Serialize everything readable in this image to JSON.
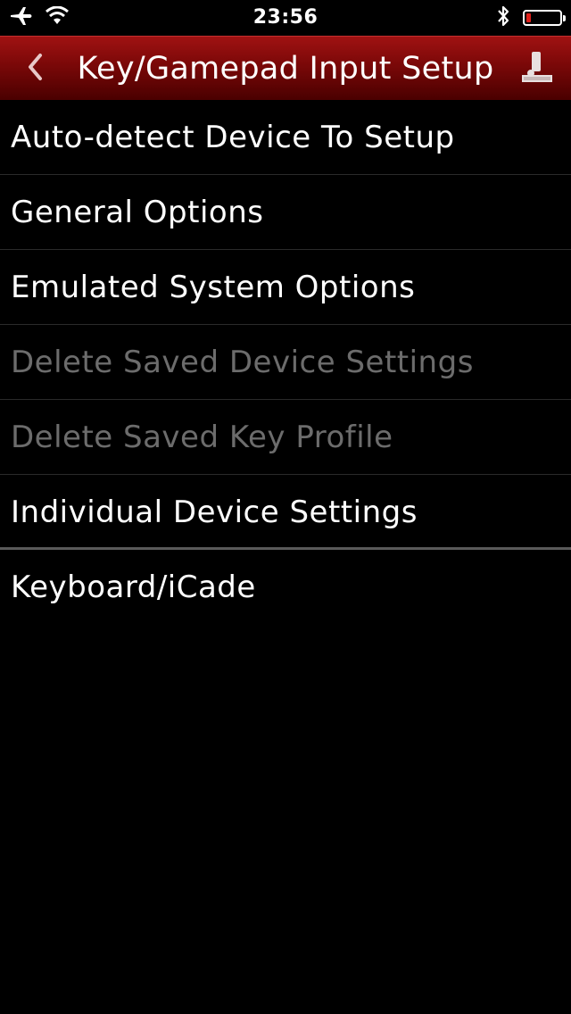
{
  "status_bar": {
    "time": "23:56",
    "airplane_icon": "airplane-icon",
    "wifi_icon": "wifi-icon",
    "bluetooth_icon": "bluetooth-icon",
    "battery_level": 0.15,
    "battery_color": "#e0201a"
  },
  "nav": {
    "title": "Key/Gamepad Input Setup",
    "back_icon": "chevron-left-icon",
    "action_icon": "joystick-icon",
    "bar_color": "#7a0808"
  },
  "menu": {
    "items": [
      {
        "label": "Auto-detect Device To Setup",
        "enabled": true
      },
      {
        "label": "General Options",
        "enabled": true
      },
      {
        "label": "Emulated System Options",
        "enabled": true
      },
      {
        "label": "Delete Saved Device Settings",
        "enabled": false
      },
      {
        "label": "Delete Saved Key Profile",
        "enabled": false
      },
      {
        "label": "Individual Device Settings",
        "enabled": true
      },
      {
        "label": "Keyboard/iCade",
        "enabled": true
      }
    ]
  }
}
